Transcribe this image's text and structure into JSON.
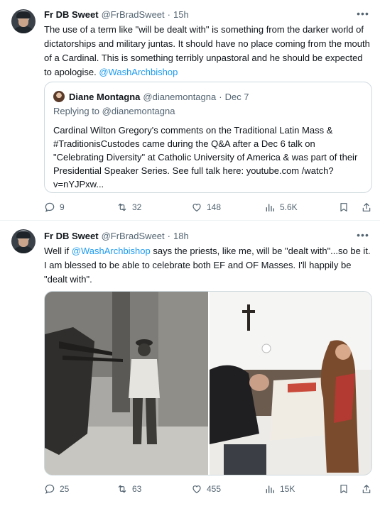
{
  "tweets": [
    {
      "author_name": "Fr DB Sweet",
      "author_handle": "@FrBradSweet",
      "separator": "·",
      "time": "15h",
      "text_before_link": "The use of a term like \"will be dealt with\" is something from the darker world of dictatorships and military juntas. It should have no place coming from the mouth of a Cardinal. This is something terribly unpastoral and he should be expected to apologise.",
      "mention": "@WashArchbishop",
      "quote": {
        "author_name": "Diane Montagna",
        "author_handle": "@dianemontagna",
        "separator": "·",
        "date": "Dec 7",
        "replying_to": "Replying to @dianemontagna",
        "text": "Cardinal Wilton Gregory's comments on the Traditional Latin Mass & #TraditionisCustodes came during the Q&A after a Dec 6 talk on \"Celebrating Diversity\" at Catholic University of America & was part of their Presidential Speaker Series. See full talk here: youtube.com /watch?v=nYJPxw..."
      },
      "actions": {
        "replies": "9",
        "reposts": "32",
        "likes": "148",
        "views": "5.6K"
      }
    },
    {
      "author_name": "Fr DB Sweet",
      "author_handle": "@FrBradSweet",
      "separator": "·",
      "time": "18h",
      "text_before_mention": "Well if ",
      "mention": "@WashArchbishop",
      "text_after_mention": " says the priests, like me, will be \"dealt with\"...so be it. I am blessed to be able to celebrate both EF and OF Masses. I'll happily be \"dealt with\".",
      "actions": {
        "replies": "25",
        "reposts": "63",
        "likes": "455",
        "views": "15K"
      }
    }
  ],
  "icons": [
    "more-icon",
    "reply-icon",
    "repost-icon",
    "like-icon",
    "views-icon",
    "bookmark-icon",
    "share-icon"
  ],
  "colors": {
    "link": "#1d9bf0",
    "secondary_text": "#536471",
    "border": "#cfd9de"
  }
}
